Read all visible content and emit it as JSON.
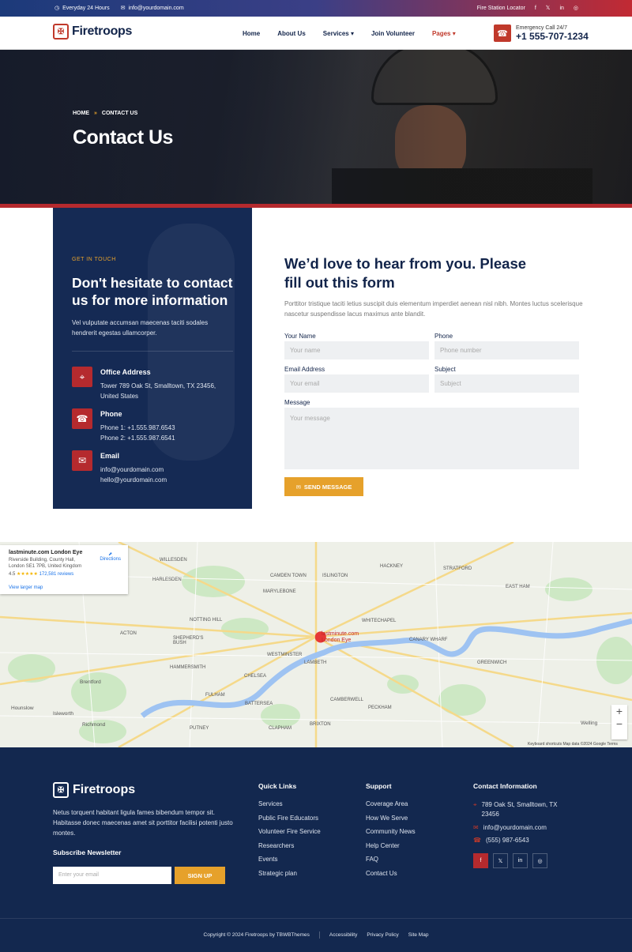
{
  "topbar": {
    "hours": "Everyday 24 Hours",
    "email": "info@yourdomain.com",
    "locator": "Fire Station Locator",
    "socials": [
      "f",
      "𝕏",
      "in",
      "◎"
    ]
  },
  "header": {
    "brand": "Firetroops",
    "nav": [
      "Home",
      "About Us",
      "Services",
      "Join Volunteer",
      "Pages"
    ],
    "emergency_label": "Emergency Call 24/7",
    "emergency_phone": "+1 555-707-1234"
  },
  "hero": {
    "crumb_home": "HOME",
    "crumb_sep": "»",
    "crumb_current": "CONTACT US",
    "title": "Contact Us"
  },
  "contact_card": {
    "eyebrow": "GET IN TOUCH",
    "title": "Don't hesitate to contact us for more information",
    "desc": "Vel vulputate accumsan maecenas taciti sodales hendrerit egestas ullamcorper.",
    "items": [
      {
        "title": "Office Address",
        "lines": [
          "Tower 789 Oak St, Smalltown, TX 23456,",
          "United States"
        ]
      },
      {
        "title": "Phone",
        "lines": [
          "Phone 1: +1.555.987.6543",
          "Phone 2: +1.555.987.6541"
        ]
      },
      {
        "title": "Email",
        "lines": [
          "info@yourdomain.com",
          "hello@yourdomain.com"
        ]
      }
    ]
  },
  "form": {
    "title": "We’d love to hear from you. Please fill out this form",
    "desc": "Porttitor tristique taciti letius suscipit duis elementum imperdiet aenean nisl nibh. Montes luctus scelerisque nascetur suspendisse lacus maximus ante blandit.",
    "name_label": "Your Name",
    "name_ph": "Your name",
    "phone_label": "Phone",
    "phone_ph": "Phone number",
    "email_label": "Email Address",
    "email_ph": "Your email",
    "subject_label": "Subject",
    "subject_ph": "Subject",
    "message_label": "Message",
    "message_ph": "Your message",
    "send": "SEND MESSAGE"
  },
  "map": {
    "place": "lastminute.com London Eye",
    "address": "Riverside Building, County Hall, London SE1 7PB, United Kingdom",
    "rating": "4.5",
    "stars": "★★★★★",
    "reviews": "172,581 reviews",
    "directions": "Directions",
    "larger": "View larger map",
    "pin_label": "lastminute.com London Eye",
    "labels": [
      "WILLESDEN",
      "CAMDEN TOWN",
      "ISLINGTON",
      "HACKNEY",
      "STRATFORD",
      "HARLESDEN",
      "MARYLEBONE",
      "EAST HAM",
      "NOTTING HILL",
      "WHITECHAPEL",
      "ACTON",
      "SHEPHERD'S BUSH",
      "WESTMINSTER",
      "LAMBETH",
      "CANARY WHARF",
      "GREENWICH",
      "HAMMERSMITH",
      "CHELSEA",
      "PECKHAM",
      "BRIXTON",
      "FULHAM",
      "PUTNEY",
      "CLAPHAM",
      "BATTERSEA",
      "Brentford",
      "Richmond",
      "Isleworth",
      "Hounslow",
      "Welling",
      "CAMBERWELL"
    ],
    "attr": "Keyboard shortcuts   Map data ©2024 Google   Terms"
  },
  "footer": {
    "brand": "Firetroops",
    "desc": "Netus torquent habitant ligula fames bibendum tempor sit. Habitasse donec maecenas amet sit porttitor facilisi potenti justo montes.",
    "newsletter": "Subscribe Newsletter",
    "email_ph": "Enter your email",
    "signup": "SIGN UP",
    "quick_title": "Quick Links",
    "quick": [
      "Services",
      "Public Fire Educators",
      "Volunteer Fire Service",
      "Researchers",
      "Events",
      "Strategic plan"
    ],
    "support_title": "Support",
    "support": [
      "Coverage Area",
      "How We Serve",
      "Community News",
      "Help Center",
      "FAQ",
      "Contact Us"
    ],
    "contact_title": "Contact Information",
    "address": "789 Oak St, Smalltown, TX 23456",
    "email": "info@yourdomain.com",
    "phone": "(555) 987-6543",
    "copyright": "Copyright © 2024 Firetroops by TBWBThemes",
    "links": [
      "Accessibility",
      "Privacy Policy",
      "Site Map"
    ]
  },
  "colors": {
    "accent": "#e6a12b",
    "brand_red": "#b52a2e",
    "navy": "#13284f"
  }
}
